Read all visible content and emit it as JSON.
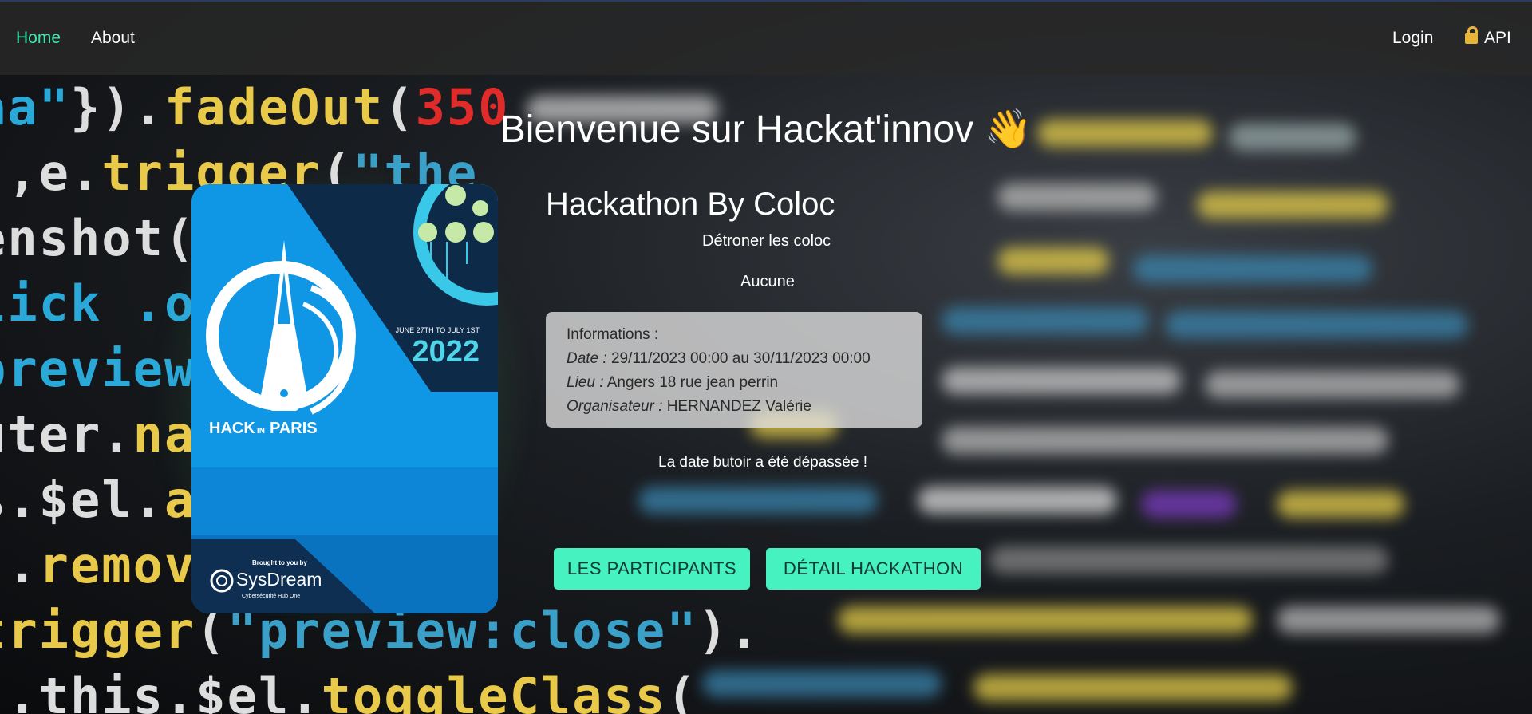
{
  "nav": {
    "home": "Home",
    "about": "About",
    "login": "Login",
    "api": "API",
    "api_icon": "lock-icon",
    "active_color": "#3fe8b3"
  },
  "hero": {
    "title": "Bienvenue sur Hackat'innov",
    "title_emoji": "👋"
  },
  "poster": {
    "dates": "JUNE 27TH TO JULY 1ST",
    "year": "2022",
    "brand_a": "HACK",
    "brand_in": "IN",
    "brand_b": "PARIS",
    "sponsor_tag": "Brought to you by",
    "sponsor": "SysDream",
    "sponsor_sub": "Cybersécurité Hub One"
  },
  "hackathon": {
    "title": "Hackathon By Coloc",
    "subtitle": "Détroner les coloc",
    "theme": "Aucune",
    "info_heading": "Informations :",
    "date_label": "Date :",
    "date_value": "29/11/2023 00:00 au 30/11/2023 00:00",
    "place_label": "Lieu :",
    "place_value": "Angers 18 rue jean perrin",
    "organizer_label": "Organisateur :",
    "organizer_value": "HERNANDEZ Valérie",
    "deadline_message": "La date butoir a été dépassée !"
  },
  "actions": {
    "participants": "LES PARTICIPANTS",
    "detail": "DÉTAIL HACKATHON",
    "button_color": "#45f2c0"
  }
}
